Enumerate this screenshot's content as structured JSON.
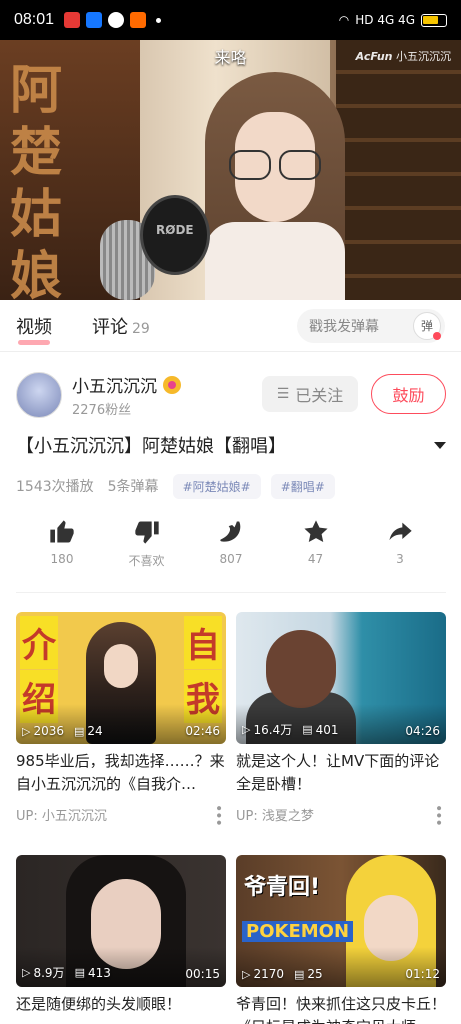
{
  "status_bar": {
    "time": "08:01",
    "apps": [
      {
        "name": "news-app-icon",
        "color": "#e53935"
      },
      {
        "name": "alipay-app-icon",
        "color": "#1677ff"
      },
      {
        "name": "quark-app-icon",
        "color": "#ffffff"
      },
      {
        "name": "shopping-app-icon",
        "color": "#ff6a00"
      }
    ],
    "right_text": "HD 4G 4G"
  },
  "player": {
    "title": "来咯",
    "watermark_brand": "AcFun",
    "watermark_user": "小五沉沉沉",
    "calligraphy": "阿楚姑娘"
  },
  "tabs": [
    {
      "label": "视频",
      "active": true
    },
    {
      "label": "评论",
      "count": "29",
      "active": false
    }
  ],
  "danmaku": {
    "placeholder": "戳我发弹幕",
    "toggle": "弹"
  },
  "uploader": {
    "name": "小五沉沉沉",
    "fans": "2276粉丝",
    "follow_label": "已关注",
    "tip_label": "鼓励"
  },
  "video": {
    "title": "【小五沉沉沉】阿楚姑娘【翻唱】",
    "plays": "1543次播放",
    "danmaku_count": "5条弹幕",
    "tags": [
      "#阿楚姑娘#",
      "#翻唱#"
    ]
  },
  "actions": [
    {
      "name": "like",
      "label": "180"
    },
    {
      "name": "dislike",
      "label": "不喜欢"
    },
    {
      "name": "banana",
      "label": "807"
    },
    {
      "name": "favorite",
      "label": "47"
    },
    {
      "name": "share",
      "label": "3"
    }
  ],
  "recommendations": [
    {
      "title": "985毕业后，我却选择……？来自小五沉沉沉的《自我介…",
      "up": "UP: 小五沉沉沉",
      "plays": "2036",
      "comments": "24",
      "duration": "02:46",
      "thumb_text": [
        "介",
        "绍",
        "自",
        "我"
      ]
    },
    {
      "title": "就是这个人！让MV下面的评论全是卧槽！",
      "up": "UP: 浅夏之梦",
      "plays": "16.4万",
      "comments": "401",
      "duration": "04:26"
    },
    {
      "title": "还是随便绑的头发顺眼！",
      "up": "",
      "plays": "8.9万",
      "comments": "413",
      "duration": "00:15"
    },
    {
      "title": "爷青回！快来抓住这只皮卡丘！《目标是成为神奇宝贝大师",
      "up": "",
      "plays": "2170",
      "comments": "25",
      "duration": "01:12",
      "thumb_text": [
        "爷青回!",
        "POKEMON"
      ]
    }
  ]
}
